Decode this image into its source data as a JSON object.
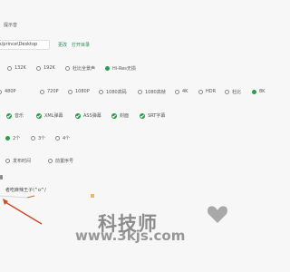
{
  "notify": {
    "label": "提示音"
  },
  "path": {
    "value": "s/prince\\Desktop",
    "change_label": "更改",
    "open_label": "打开目录"
  },
  "audio": {
    "options": [
      {
        "label": "132K",
        "checked": false
      },
      {
        "label": "192K",
        "checked": false
      },
      {
        "label": "杜比全景声",
        "checked": false
      },
      {
        "label": "Hi-Res无损",
        "checked": true
      }
    ]
  },
  "video": {
    "options": [
      {
        "label": "480P",
        "checked": false
      },
      {
        "label": "720P",
        "checked": false
      },
      {
        "label": "1080P",
        "checked": false
      },
      {
        "label": "1080高码",
        "checked": false
      },
      {
        "label": "1080高帧",
        "checked": false
      },
      {
        "label": "4K",
        "checked": false
      },
      {
        "label": "HDR",
        "checked": false
      },
      {
        "label": "杜比",
        "checked": false
      },
      {
        "label": "8K",
        "checked": true
      }
    ]
  },
  "content": {
    "options": [
      {
        "label": "音乐",
        "checked": true
      },
      {
        "label": "XML弹幕",
        "checked": true
      },
      {
        "label": "ASS弹幕",
        "checked": true
      },
      {
        "label": "封面",
        "checked": true
      },
      {
        "label": "SRT字幕",
        "checked": true
      }
    ]
  },
  "threads": {
    "options": [
      {
        "label": "2个",
        "checked": true
      },
      {
        "label": "3个",
        "checked": false
      },
      {
        "label": "4个",
        "checked": false
      }
    ]
  },
  "naming": {
    "options": [
      {
        "label": "发布时间",
        "checked": false
      },
      {
        "label": "前置序号",
        "checked": false
      }
    ]
  },
  "comment": {
    "text": "者吃麻辣王子\\^o^/"
  },
  "watermark": {
    "text": "科技师",
    "url": "www.3kjs.com"
  },
  "colors": {
    "accent": "#2e9a4e",
    "link": "#2e8b57"
  }
}
